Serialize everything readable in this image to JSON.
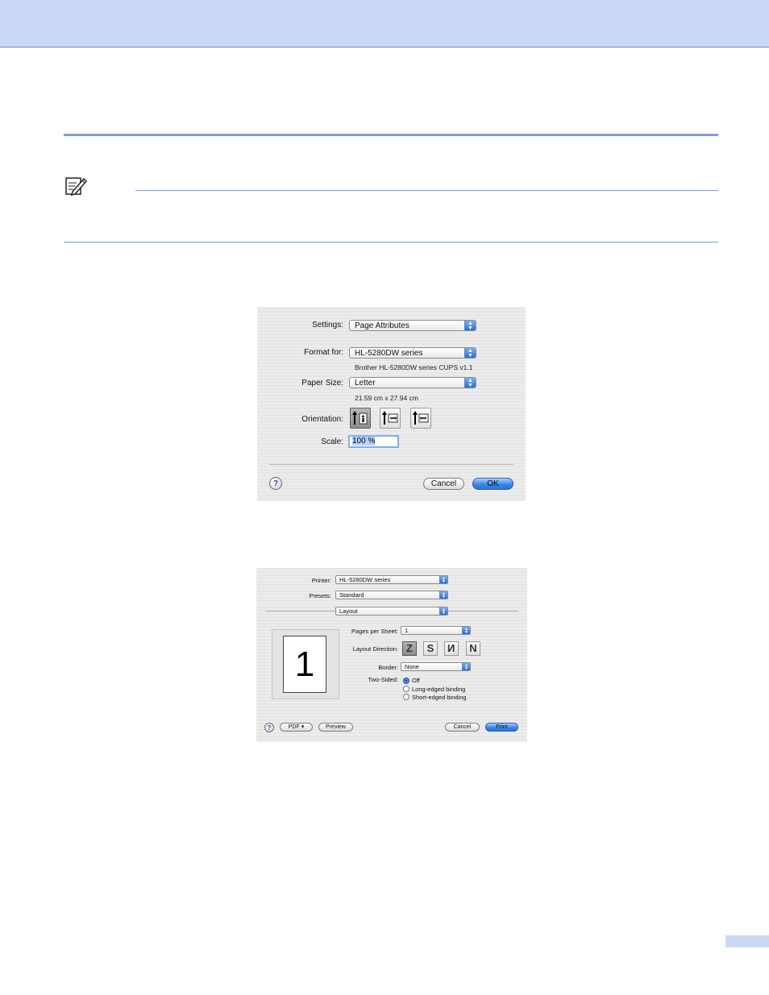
{
  "page_setup": {
    "settings_label": "Settings:",
    "settings_value": "Page Attributes",
    "format_label": "Format for:",
    "format_value": "HL-5280DW series",
    "format_desc": "Brother HL-5280DW series CUPS v1.1",
    "paper_label": "Paper Size:",
    "paper_value": "Letter",
    "paper_desc": "21.59 cm x 27.94 cm",
    "orientation_label": "Orientation:",
    "scale_label": "Scale:",
    "scale_value": "100 %",
    "help": "?",
    "cancel": "Cancel",
    "ok": "OK"
  },
  "print_dialog": {
    "printer_label": "Printer:",
    "printer_value": "HL-5280DW series",
    "presets_label": "Presets:",
    "presets_value": "Standard",
    "panel_value": "Layout",
    "preview_digit": "1",
    "pages_label": "Pages per Sheet:",
    "pages_value": "1",
    "direction_label": "Layout Direction:",
    "border_label": "Border:",
    "border_value": "None",
    "two_sided_label": "Two-Sided:",
    "two_sided_options": [
      "Off",
      "Long-edged binding",
      "Short-edged binding"
    ],
    "help": "?",
    "pdf": "PDF ▾",
    "preview": "Preview",
    "cancel": "Cancel",
    "print": "Print"
  },
  "colors": {
    "header_band": "#c9d9f7",
    "rule": "#7b9de6",
    "accent_button": "#3b86ea"
  }
}
